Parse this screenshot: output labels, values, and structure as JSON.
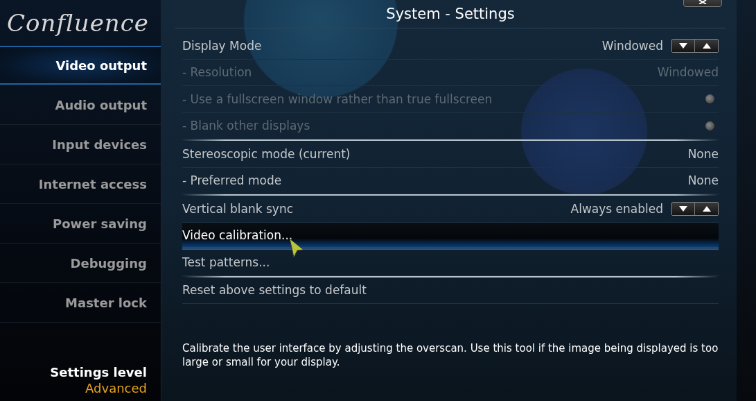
{
  "logo": "Confluence",
  "sidebar": {
    "items": [
      {
        "label": "Video output",
        "selected": true
      },
      {
        "label": "Audio output",
        "selected": false
      },
      {
        "label": "Input devices",
        "selected": false
      },
      {
        "label": "Internet access",
        "selected": false
      },
      {
        "label": "Power saving",
        "selected": false
      },
      {
        "label": "Debugging",
        "selected": false
      },
      {
        "label": "Master lock",
        "selected": false
      }
    ],
    "settings_level": {
      "label": "Settings level",
      "value": "Advanced"
    }
  },
  "window": {
    "title": "System - Settings"
  },
  "groups": [
    {
      "rows": [
        {
          "kind": "spinner",
          "label": "Display Mode",
          "value": "Windowed",
          "disabled": false,
          "selected": false
        },
        {
          "kind": "value",
          "label": "- Resolution",
          "value": "Windowed",
          "disabled": true,
          "selected": false
        },
        {
          "kind": "toggle",
          "label": "- Use a fullscreen window rather than true fullscreen",
          "on": false,
          "disabled": true,
          "selected": false
        },
        {
          "kind": "toggle",
          "label": "- Blank other displays",
          "on": false,
          "disabled": true,
          "selected": false
        }
      ]
    },
    {
      "rows": [
        {
          "kind": "value",
          "label": "Stereoscopic mode (current)",
          "value": "None",
          "disabled": false,
          "selected": false
        },
        {
          "kind": "value",
          "label": "- Preferred mode",
          "value": "None",
          "disabled": false,
          "selected": false
        }
      ]
    },
    {
      "rows": [
        {
          "kind": "spinner",
          "label": "Vertical blank sync",
          "value": "Always enabled",
          "disabled": false,
          "selected": false
        },
        {
          "kind": "action",
          "label": "Video calibration...",
          "disabled": false,
          "selected": true
        },
        {
          "kind": "action",
          "label": "Test patterns...",
          "disabled": false,
          "selected": false
        }
      ]
    },
    {
      "rows": [
        {
          "kind": "action",
          "label": "Reset above settings to default",
          "disabled": false,
          "selected": false
        }
      ]
    }
  ],
  "description": "Calibrate the user interface by adjusting the overscan. Use this tool if the image being displayed is too large or small for your display."
}
